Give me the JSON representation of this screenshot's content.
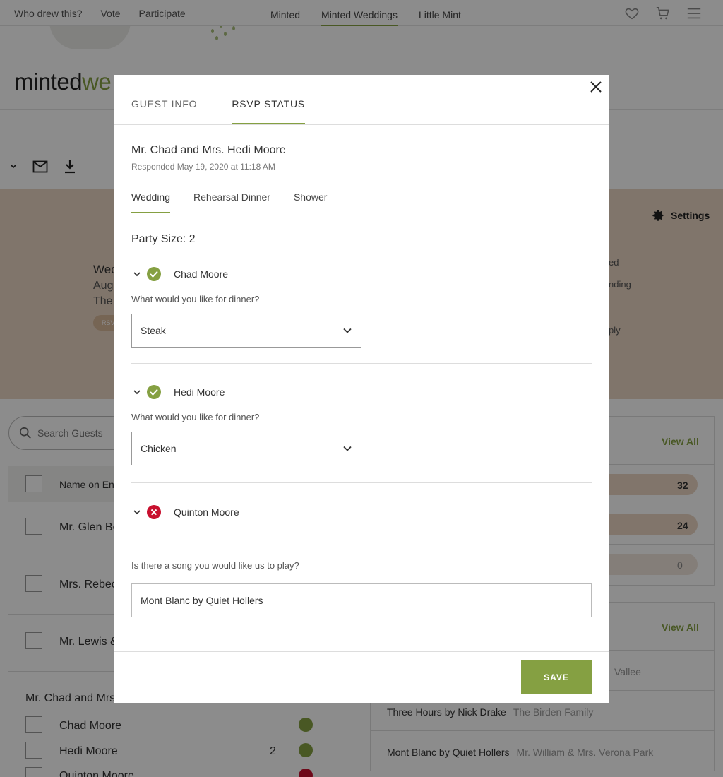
{
  "topnav": {
    "left_links": [
      "Who drew this?",
      "Vote",
      "Participate"
    ],
    "center_links": [
      "Minted",
      "Minted Weddings",
      "Little Mint"
    ],
    "active_center": "Minted Weddings"
  },
  "logo": {
    "part1": "minted",
    "part2": "we"
  },
  "settings_label": "Settings",
  "background": {
    "left_lines": [
      "Wed",
      "Augu",
      "The "
    ],
    "rsvp_pill": "RSVP",
    "right_lines": [
      "ed",
      "nding",
      "ply"
    ],
    "search_placeholder": "Search Guests",
    "list_header": "Name on Env",
    "rows": [
      "Mr. Glen Be",
      "Mrs. Rebecc",
      "Mr. Lewis &"
    ],
    "party_group": "Mr. Chad and Mrs",
    "party_members": [
      {
        "name": "Chad Moore",
        "count": "",
        "status": "attending"
      },
      {
        "name": "Hedi Moore",
        "count": "2",
        "status": "attending"
      },
      {
        "name": "Quinton Moore",
        "count": "",
        "status": "declined"
      }
    ],
    "view_all": "View All",
    "bar_values": [
      "32",
      "24",
      "0"
    ],
    "song_rows": [
      {
        "song": "",
        "by": "Vallee"
      },
      {
        "song": "Three Hours by Nick Drake",
        "by": "The Birden Family"
      },
      {
        "song": "Mont Blanc by Quiet Hollers",
        "by": "Mr. William & Mrs. Verona Park"
      }
    ]
  },
  "modal": {
    "tabs": [
      "GUEST INFO",
      "RSVP STATUS"
    ],
    "active_tab": "RSVP STATUS",
    "guest_name": "Mr. Chad and Mrs. Hedi Moore",
    "responded": "Responded May 19, 2020 at 11:18 AM",
    "event_tabs": [
      "Wedding",
      "Rehearsal Dinner",
      "Shower"
    ],
    "active_event": "Wedding",
    "party_size": "Party Size: 2",
    "guests": [
      {
        "name": "Chad Moore",
        "status": "attending",
        "question": "What would you like for dinner?",
        "answer": "Steak"
      },
      {
        "name": "Hedi Moore",
        "status": "attending",
        "question": "What would you like for dinner?",
        "answer": "Chicken"
      },
      {
        "name": "Quinton Moore",
        "status": "declined"
      }
    ],
    "song_question": "Is there a song you would like us to play?",
    "song_answer": "Mont Blanc by Quiet Hollers",
    "save_label": "SAVE"
  },
  "colors": {
    "accent": "#85a042",
    "decline": "#c8102e",
    "banner": "#e9d5c3"
  }
}
